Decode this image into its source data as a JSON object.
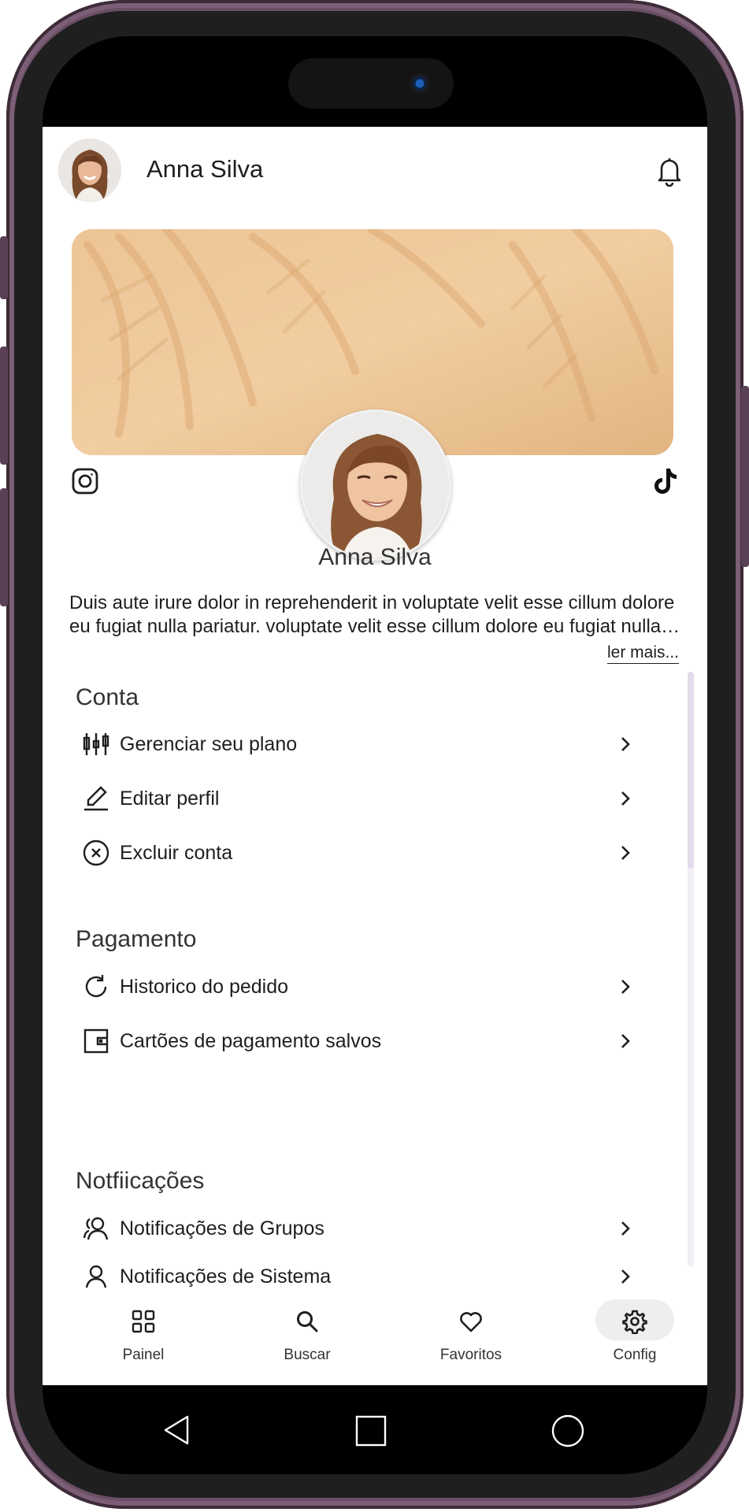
{
  "header": {
    "user_name": "Anna Silva"
  },
  "profile": {
    "name": "Anna Silva",
    "bio": "Duis aute irure dolor in reprehenderit in voluptate velit esse cillum dolore eu fugiat nulla pariatur.  voluptate velit esse cillum dolore eu fugiat nulla pariatur.",
    "read_more": "ler mais..."
  },
  "sections": {
    "account": {
      "title": "Conta",
      "items": [
        {
          "label": "Gerenciar seu plano",
          "icon": "plan-icon"
        },
        {
          "label": "Editar perfil",
          "icon": "edit-icon"
        },
        {
          "label": "Excluir conta",
          "icon": "delete-circle-icon"
        }
      ]
    },
    "payment": {
      "title": "Pagamento",
      "items": [
        {
          "label": "Historico do pedido",
          "icon": "refresh-icon"
        },
        {
          "label": "Cartões de pagamento salvos",
          "icon": "wallet-icon"
        }
      ]
    },
    "notifications": {
      "title": "Notfiicações",
      "items": [
        {
          "label": "Notificações de Grupos",
          "icon": "group-icon"
        },
        {
          "label": "Notificações de Sistema",
          "icon": "user-icon"
        }
      ]
    }
  },
  "nav": {
    "items": [
      {
        "label": "Painel",
        "icon": "grid-icon"
      },
      {
        "label": "Buscar",
        "icon": "search-icon"
      },
      {
        "label": "Favoritos",
        "icon": "heart-icon"
      },
      {
        "label": "Config",
        "icon": "gear-icon"
      }
    ],
    "active_index": 3
  },
  "colors": {
    "frame": "#6b4f66",
    "banner": "#e8c08e",
    "text": "#1e1e1e",
    "scroll_thumb": "#e3dcec",
    "active_pill": "#eeeeee"
  }
}
